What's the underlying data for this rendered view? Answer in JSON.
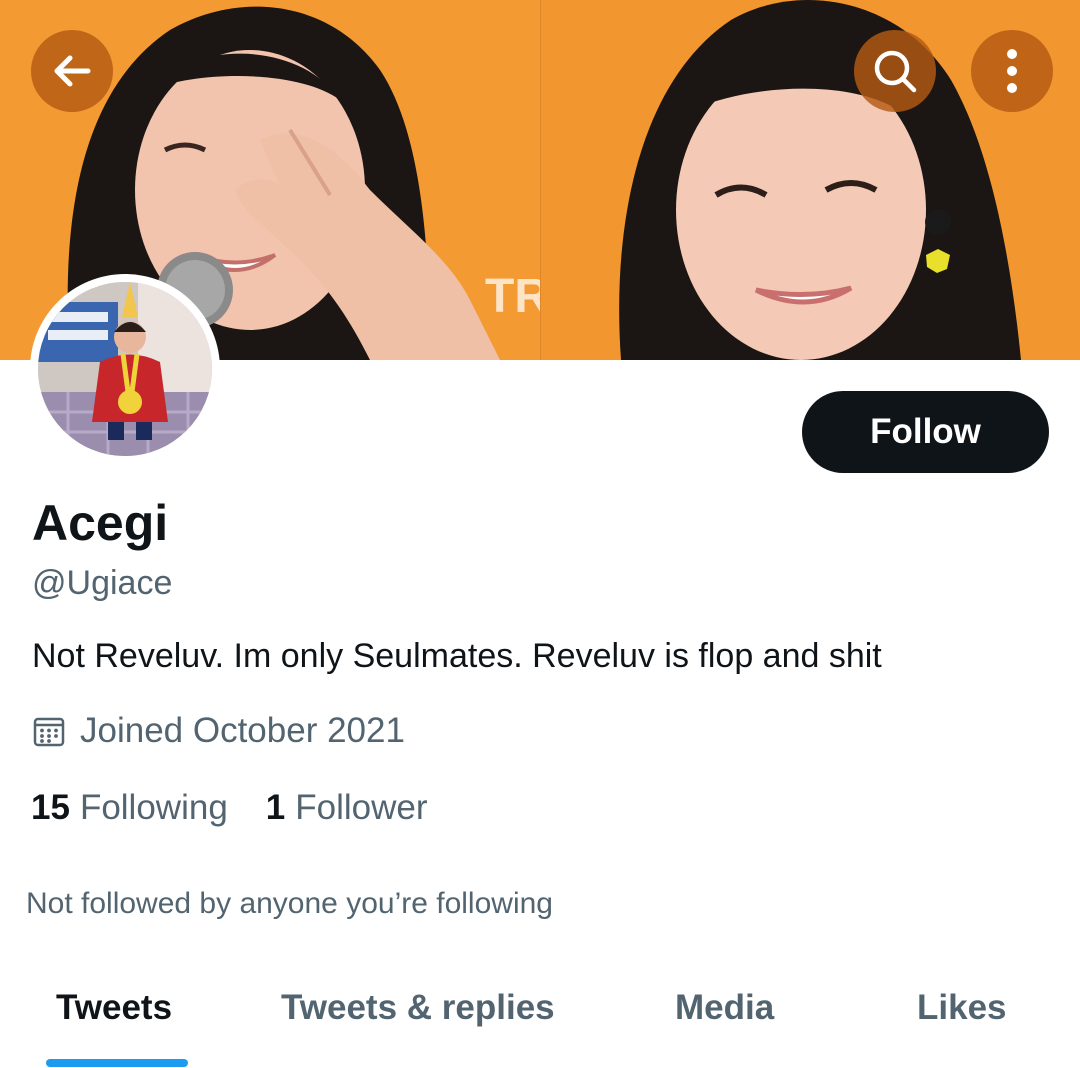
{
  "header": {
    "back_icon": "arrow-left-icon",
    "search_icon": "search-icon",
    "more_icon": "more-vertical-icon",
    "banner_colors": {
      "background": "#f39a33",
      "hair": "#1b1613",
      "skin": "#f2c3ad"
    }
  },
  "profile": {
    "display_name": "Acegi",
    "handle": "@Ugiace",
    "bio": "Not Reveluv. Im only Seulmates. Reveluv is flop and shit",
    "joined": "Joined October 2021",
    "joined_icon": "calendar-icon",
    "following_count": "15",
    "following_label": "Following",
    "followers_count": "1",
    "followers_label": "Follower",
    "not_followed_text": "Not followed by anyone you’re following"
  },
  "actions": {
    "follow_label": "Follow"
  },
  "tabs": [
    {
      "label": "Tweets",
      "active": true
    },
    {
      "label": "Tweets & replies",
      "active": false
    },
    {
      "label": "Media",
      "active": false
    },
    {
      "label": "Likes",
      "active": false
    }
  ],
  "colors": {
    "accent": "#1d9bf0",
    "text_primary": "#0f1419",
    "text_secondary": "#536471",
    "button_dark": "#0f1419"
  }
}
